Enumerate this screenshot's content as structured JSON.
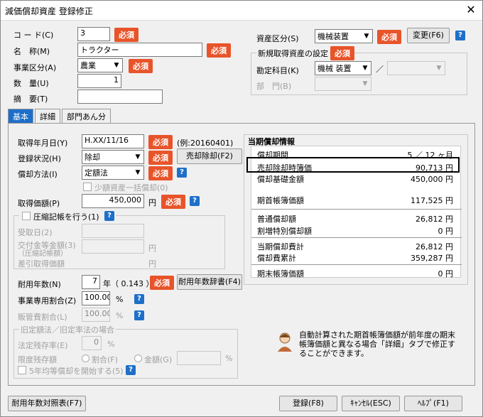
{
  "window": {
    "title": "減価償却資産 登録修正",
    "close": "✕"
  },
  "required": "必須",
  "help": "?",
  "top": {
    "code_label": "コ ー ド(C)",
    "code_value": "3",
    "name_label": "名　称(M)",
    "name_value": "トラクター",
    "biz_label": "事業区分(A)",
    "biz_value": "農業",
    "qty_label": "数　量(U)",
    "qty_value": "1",
    "memo_label": "摘　要(T)",
    "memo_value": "",
    "asset_label": "資産区分(S)",
    "asset_value": "機械装置",
    "change_button": "変更(F6)",
    "new_group_label": "新規取得資産の設定",
    "account_label": "勘定科目(K)",
    "account_value": "機械 装置",
    "slash": "／",
    "dept_label": "部　門(B)"
  },
  "tabs": [
    "基本",
    "詳細",
    "部門あん分"
  ],
  "basic": {
    "acq_date_label": "取得年月日(Y)",
    "acq_date_value": "H.XX/11/16",
    "acq_date_example": "(例:20160401)",
    "status_label": "登録状況(H)",
    "status_value": "除却",
    "sell_button": "売却除却(F2)",
    "method_label": "償却方法(I)",
    "method_value": "定額法",
    "small_lump_label": "少額資産一括償却(0)",
    "cost_label": "取得価額(P)",
    "cost_value": "450,000",
    "yen": "円",
    "compress_label": "圧縮記帳を行う(1)",
    "receipt_date_label": "受取日(2)",
    "grant_label": "交付金等金額(3)",
    "grant_sub": "（圧縮記帳額）",
    "diff_label": "差引取得価額",
    "life_label": "耐用年数(N)",
    "life_value": "7",
    "life_unit": "年（ 0.143 ）",
    "life_button": "耐用年数辞書(F4)",
    "biz_ratio_label": "事業専用割合(Z)",
    "biz_ratio_value": "100.00",
    "pct": "%",
    "admin_ratio_label": "販管費割合(L)",
    "admin_ratio_value": "100.00",
    "old_method_group": "旧定額法／旧定率法の場合",
    "residual_rate_label": "法定残存率(E)",
    "residual_rate_value": "0",
    "limit_label": "限度残存額",
    "ratio_opt": "割合(F)",
    "amount_opt": "金額(G)",
    "five_year_label": "5年均等償却を開始する(5)"
  },
  "info": {
    "title": "当期償却情報",
    "rows": [
      {
        "label": "償却期間",
        "value": "5 ／ 12 ヶ月"
      },
      {
        "label": "売却除却時簿価",
        "value": "90,713 円"
      },
      {
        "label": "償却基礎金額",
        "value": "450,000 円"
      },
      {
        "label": "期首帳簿価額",
        "value": "117,525 円"
      },
      {
        "label": "普通償却額",
        "value": "26,812 円"
      },
      {
        "label": "割増特別償却額",
        "value": "0 円"
      },
      {
        "label": "当期償却費計",
        "value": "26,812 円"
      },
      {
        "label": "償却費累計",
        "value": "359,287 円"
      },
      {
        "label": "期末帳簿価額",
        "value": "0 円"
      }
    ]
  },
  "notice": "自動計算された期首帳簿価額が前年度の期末帳簿価額と異なる場合「詳細」タブで修正することができます。",
  "footer": {
    "table_button": "耐用年数対照表(F7)",
    "register_button": "登録(F8)",
    "cancel_button": "ｷｬﾝｾﾙ(ESC)",
    "help_button": "ﾍﾙﾌﾟ(F1)"
  }
}
